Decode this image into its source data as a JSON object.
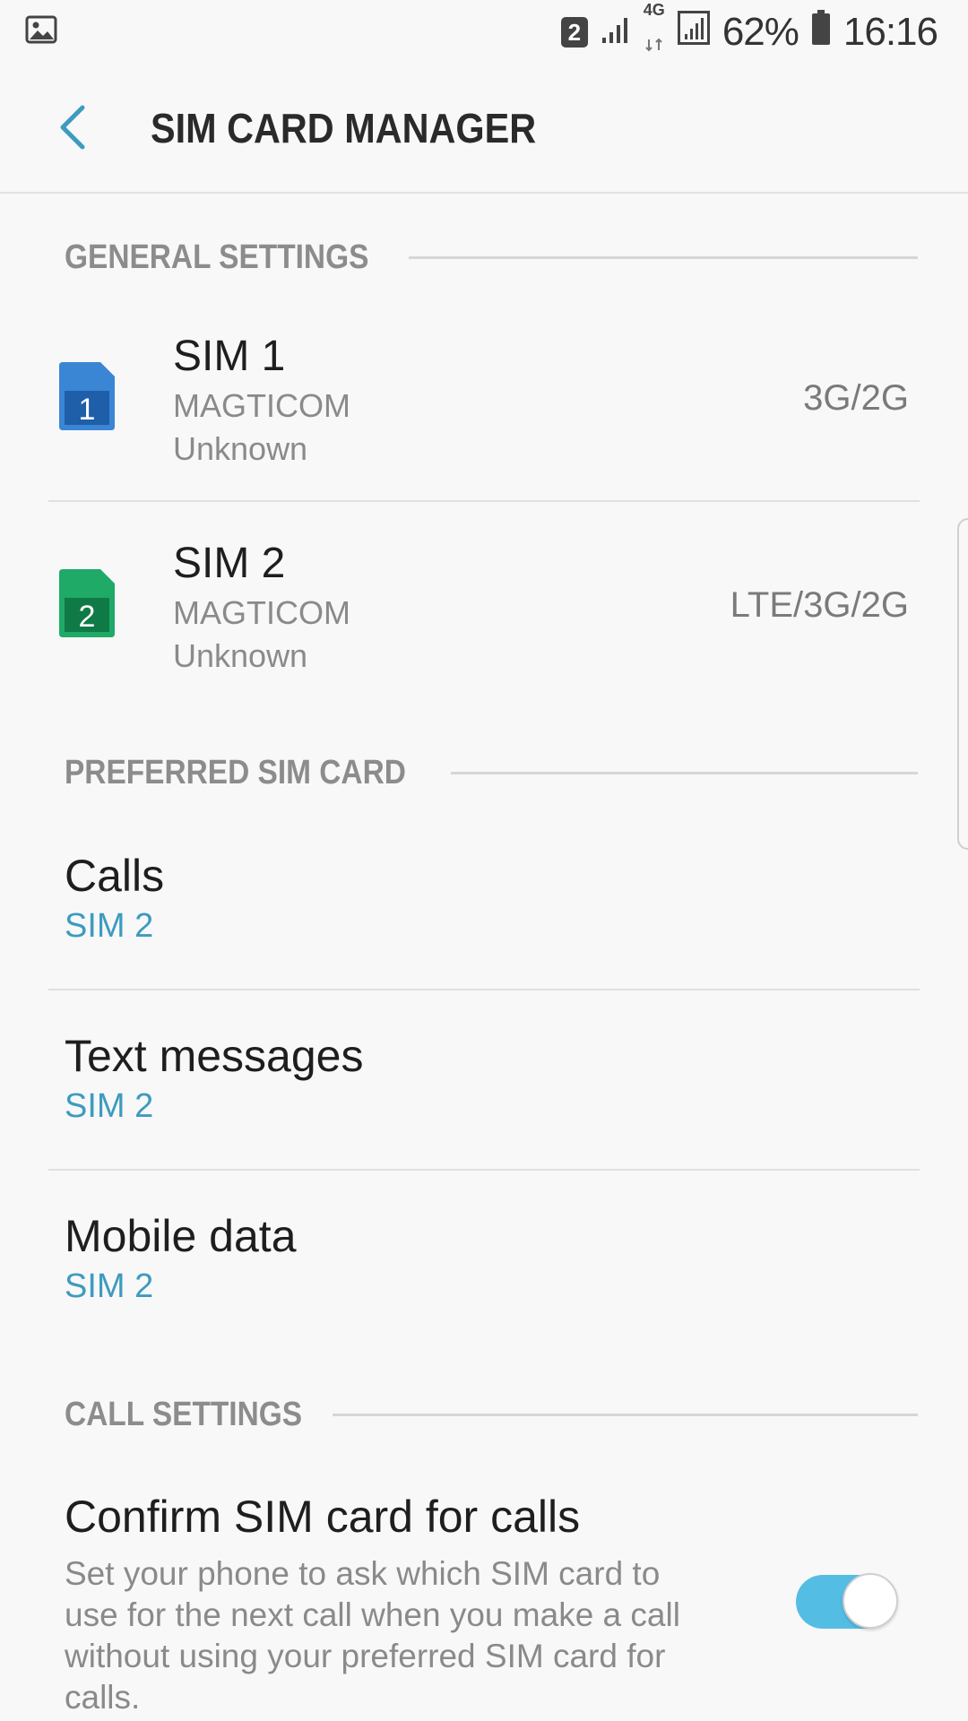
{
  "status_bar": {
    "sim_badge": "2",
    "network_label": "4G",
    "battery": "62%",
    "time": "16:16",
    "icons": [
      "gallery-icon",
      "sim-badge-icon",
      "signal-icon",
      "data-arrows-icon",
      "signal-boxed-icon",
      "battery-icon"
    ]
  },
  "header": {
    "title": "SIM CARD MANAGER",
    "back_icon": "chevron-left-icon"
  },
  "general_settings": {
    "label": "GENERAL SETTINGS",
    "sims": [
      {
        "name": "SIM 1",
        "number": "1",
        "carrier": "MAGTICOM",
        "status": "Unknown",
        "network": "3G/2G",
        "color": "#3a86d4",
        "dark": "#1f5ea8"
      },
      {
        "name": "SIM 2",
        "number": "2",
        "carrier": "MAGTICOM",
        "status": "Unknown",
        "network": "LTE/3G/2G",
        "color": "#1faa67",
        "dark": "#0f7a46"
      }
    ]
  },
  "preferred_sim": {
    "label": "PREFERRED SIM CARD",
    "items": [
      {
        "title": "Calls",
        "value": "SIM 2"
      },
      {
        "title": "Text messages",
        "value": "SIM 2"
      },
      {
        "title": "Mobile data",
        "value": "SIM 2"
      }
    ]
  },
  "call_settings": {
    "label": "CALL SETTINGS",
    "confirm": {
      "title": "Confirm SIM card for calls",
      "description": "Set your phone to ask which SIM card to use for the next call when you make a call without using your preferred SIM card for calls.",
      "enabled": true
    }
  },
  "colors": {
    "accent": "#3d9bbf",
    "toggle_on": "#54bde4",
    "section_text": "#8c8c8c"
  }
}
